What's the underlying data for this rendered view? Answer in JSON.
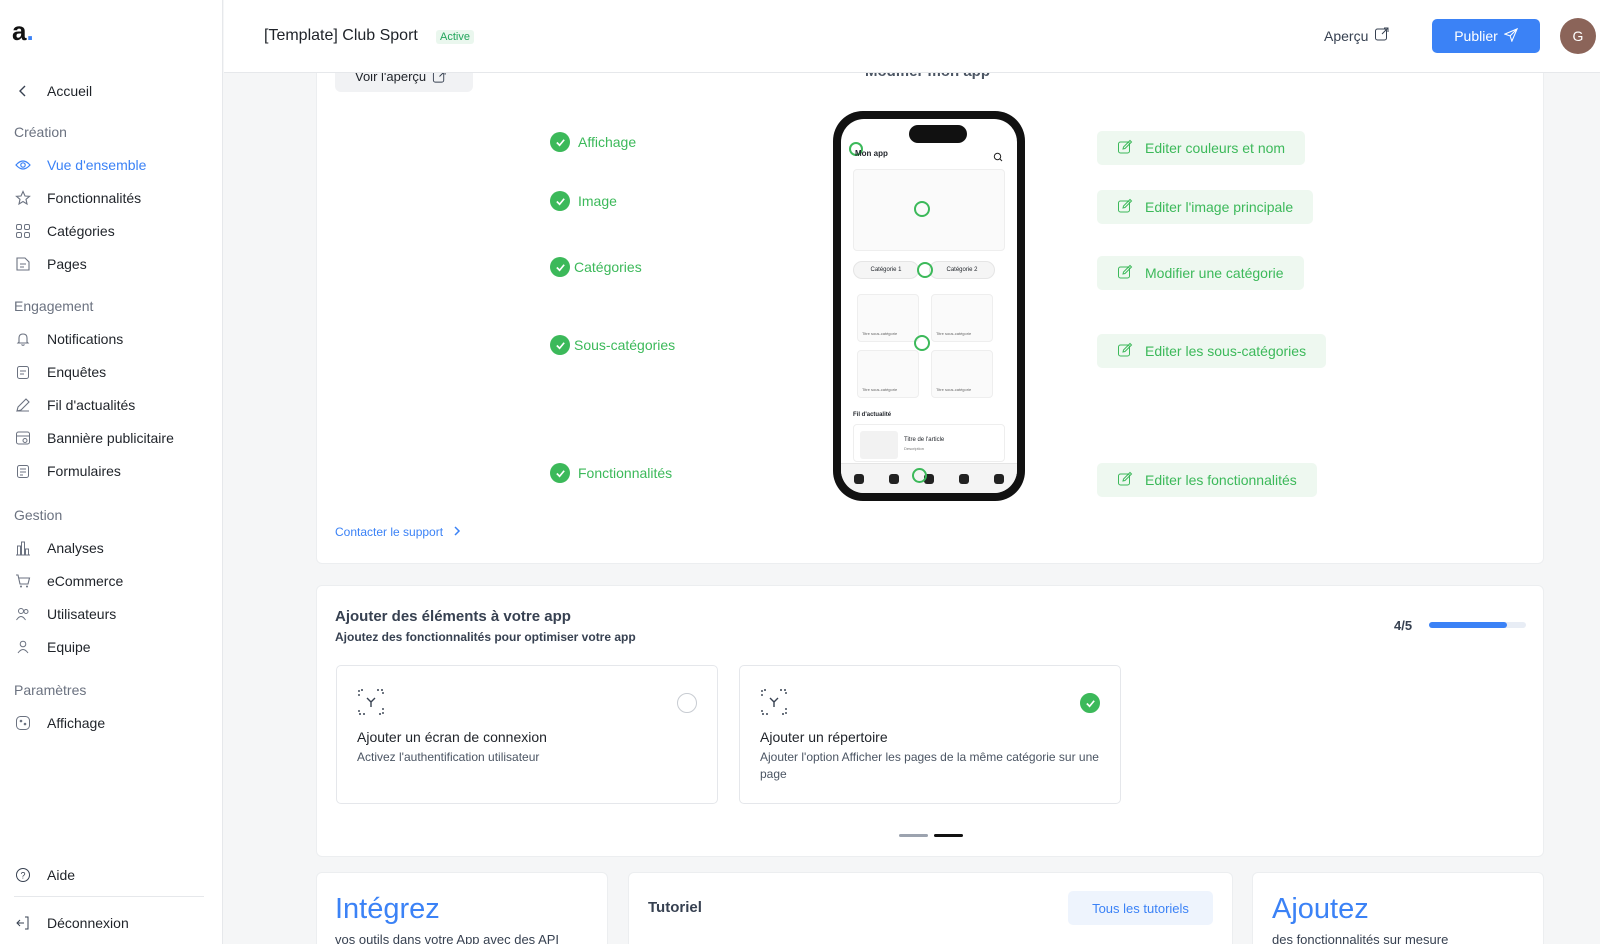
{
  "sidebar": {
    "logo": "a",
    "logo_dot": ".",
    "home": "Accueil",
    "sections": [
      {
        "title": "Création",
        "items": [
          {
            "label": "Vue d'ensemble",
            "icon": "eye-icon"
          },
          {
            "label": "Fonctionnalités",
            "icon": "star-icon"
          },
          {
            "label": "Catégories",
            "icon": "grid-icon"
          },
          {
            "label": "Pages",
            "icon": "page-icon"
          }
        ]
      },
      {
        "title": "Engagement",
        "items": [
          {
            "label": "Notifications",
            "icon": "bell-icon"
          },
          {
            "label": "Enquêtes",
            "icon": "clipboard-icon"
          },
          {
            "label": "Fil d'actualités",
            "icon": "pen-icon"
          },
          {
            "label": "Bannière publicitaire",
            "icon": "banner-icon"
          },
          {
            "label": "Formulaires",
            "icon": "form-icon"
          }
        ]
      },
      {
        "title": "Gestion",
        "items": [
          {
            "label": "Analyses",
            "icon": "bar-chart-icon"
          },
          {
            "label": "eCommerce",
            "icon": "cart-icon"
          },
          {
            "label": "Utilisateurs",
            "icon": "users-icon"
          },
          {
            "label": "Equipe",
            "icon": "user-icon"
          }
        ]
      },
      {
        "title": "Paramètres",
        "items": [
          {
            "label": "Affichage",
            "icon": "palette-icon"
          }
        ]
      }
    ],
    "help": "Aide",
    "logout": "Déconnexion"
  },
  "header": {
    "title": "[Template] Club Sport",
    "status": "Active",
    "preview": "Aperçu",
    "publish": "Publier",
    "avatar_initial": "G"
  },
  "overview": {
    "preview_button": "Voir l'aperçu",
    "heading": "Modifier mon app",
    "features": [
      "Affichage",
      "Image",
      "Catégories",
      "Sous-catégories",
      "Fonctionnalités"
    ],
    "edit_buttons": [
      "Editer couleurs et nom",
      "Editer l'image principale",
      "Modifier une catégorie",
      "Editer les sous-catégories",
      "Editer les fonctionnalités"
    ],
    "support_link": "Contacter le support",
    "phone": {
      "app_name": "Mon app",
      "chip1": "Catégorie 1",
      "chip2": "Catégorie 2",
      "tile_label": "Titre sous-catégorie",
      "section": "Fil d'actualité",
      "article_title": "Titre de l'article",
      "article_desc": "Description"
    }
  },
  "add_elements": {
    "title": "Ajouter des éléments à votre app",
    "subtitle": "Ajoutez des fonctionnalités pour optimiser votre app",
    "progress_label": "4/5",
    "progress_value": 0.8,
    "cards": [
      {
        "title": "Ajouter un écran de connexion",
        "desc": "Activez l'authentification utilisateur",
        "done": false
      },
      {
        "title": "Ajouter un répertoire",
        "desc": "Ajouter l'option Afficher les pages de la même catégorie sur une page",
        "done": true
      }
    ]
  },
  "bottom": {
    "integrate_title": "Intégrez",
    "integrate_desc": "vos outils dans votre App avec des API",
    "tutorial_title": "Tutoriel",
    "tutorial_button": "Tous les tutoriels",
    "add_title": "Ajoutez",
    "add_desc": "des fonctionnalités sur mesure"
  },
  "colors": {
    "accent": "#3b82f6",
    "success": "#3cb95a"
  }
}
